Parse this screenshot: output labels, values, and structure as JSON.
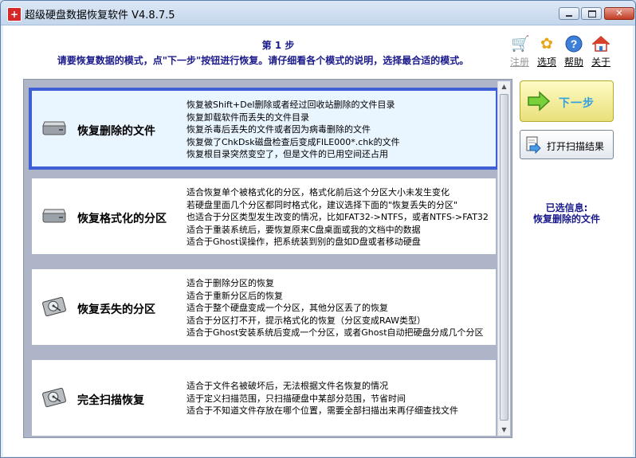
{
  "window": {
    "title": "超级硬盘数据恢复软件 V4.8.7.5"
  },
  "header": {
    "step_title": "第 1 步",
    "instruction": "请要恢复数据的模式，点\"下一步\"按钮进行恢复。请仔细看各个模式的说明，选择最合适的模式。"
  },
  "toolbar": [
    {
      "label": "注册",
      "icon": "cart-icon",
      "enabled": false
    },
    {
      "label": "选项",
      "icon": "gear-icon",
      "enabled": true
    },
    {
      "label": "帮助",
      "icon": "help-icon",
      "enabled": true
    },
    {
      "label": "关于",
      "icon": "house-icon",
      "enabled": true
    }
  ],
  "modes": [
    {
      "name": "恢复删除的文件",
      "icon": "disk-icon",
      "selected": true,
      "lines": [
        "恢复被Shift+Del删除或者经过回收站删除的文件目录",
        "恢复卸载软件而丢失的文件目录",
        "恢复杀毒后丢失的文件或者因为病毒删除的文件",
        "恢复做了ChkDsk磁盘检查后变成FILE000*.chk的文件",
        "恢复根目录突然变空了，但是文件的已用空间还占用"
      ]
    },
    {
      "name": "恢复格式化的分区",
      "icon": "disk-icon",
      "selected": false,
      "lines": [
        "适合恢复单个被格式化的分区，格式化前后这个分区大小未发生变化",
        "若硬盘里面几个分区都同时格式化，建议选择下面的\"恢复丢失的分区\"",
        "也适合于分区类型发生改变的情况，比如FAT32->NTFS，或者NTFS->FAT32",
        "适合于重装系统后，要恢复原来C盘桌面或我的文档中的数据",
        "适合于Ghost误操作，把系统装到别的盘如D盘或者移动硬盘"
      ]
    },
    {
      "name": "恢复丢失的分区",
      "icon": "harddrive-icon",
      "selected": false,
      "lines": [
        "适合于删除分区的恢复",
        "适合于重新分区后的恢复",
        "适合于整个硬盘变成一个分区，其他分区丢了的恢复",
        "适合于分区打不开，提示格式化的恢复（分区变成RAW类型）",
        "适合于Ghost安装系统后变成一个分区，或者Ghost自动把硬盘分成几个分区"
      ]
    },
    {
      "name": "完全扫描恢复",
      "icon": "harddrive-icon",
      "selected": false,
      "lines": [
        "适合于文件名被破坏后，无法根据文件名恢复的情况",
        "适于定义扫描范围，只扫描硬盘中某部分范围，节省时间",
        "适合于不知道文件存放在哪个位置，需要全部扫描出来再仔细查找文件"
      ]
    }
  ],
  "side": {
    "next_label": "下一步",
    "open_scan_label": "打开扫描结果",
    "info_title": "已选信息:",
    "info_value": "恢复删除的文件"
  }
}
